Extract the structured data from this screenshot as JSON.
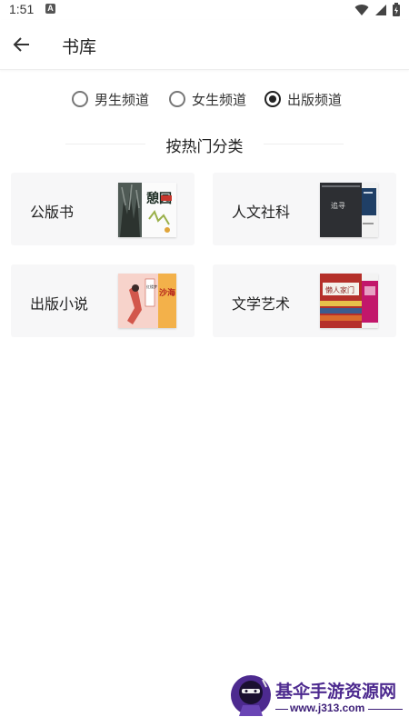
{
  "status_bar": {
    "time": "1:51",
    "notification_icon": "a-box-icon",
    "icons": [
      "wifi-icon",
      "signal-icon",
      "battery-icon"
    ]
  },
  "app_bar": {
    "back_icon": "arrow-left-icon",
    "title": "书库"
  },
  "channels": [
    {
      "label": "男生频道",
      "selected": false
    },
    {
      "label": "女生频道",
      "selected": false
    },
    {
      "label": "出版频道",
      "selected": true
    }
  ],
  "section": {
    "title": "按热门分类"
  },
  "categories": [
    {
      "label": "公版书",
      "cover_text": "憩园"
    },
    {
      "label": "人文社科",
      "cover_text": "追寻"
    },
    {
      "label": "出版小说",
      "cover_text": "沙海",
      "cover_text_2": "红楼梦"
    },
    {
      "label": "文学艺术",
      "cover_text": "懒人家门"
    }
  ],
  "watermark": {
    "name": "基伞手游资源网",
    "url": "www.j313.com"
  },
  "colors": {
    "card_bg": "#f7f7f8",
    "text": "#222222",
    "watermark": "#4d2a8f"
  }
}
